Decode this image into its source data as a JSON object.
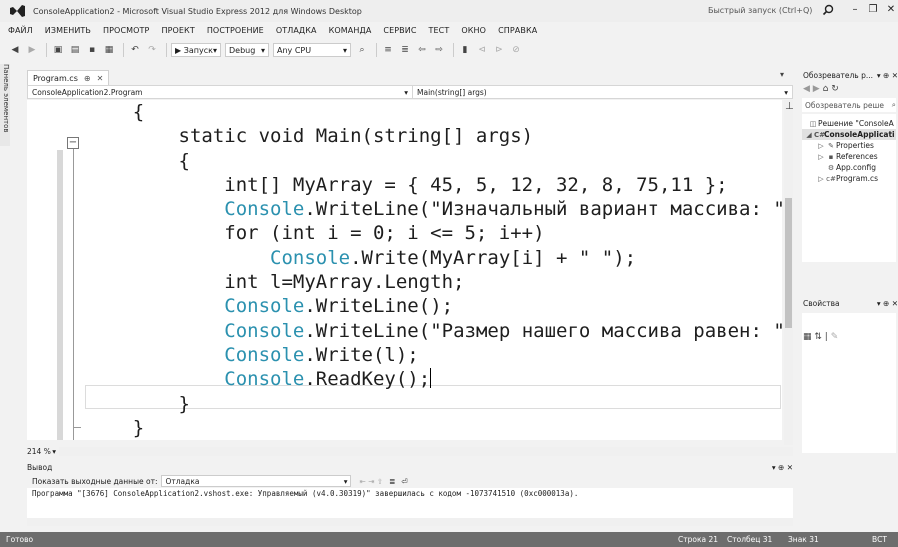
{
  "window": {
    "title": "ConsoleApplication2 - Microsoft Visual Studio Express 2012 для Windows Desktop",
    "quick_launch_placeholder": "Быстрый запуск (Ctrl+Q)",
    "controls": {
      "minimize": "–",
      "restore": "❐",
      "close": "✕"
    }
  },
  "menu": [
    "ФАЙЛ",
    "ИЗМЕНИТЬ",
    "ПРОСМОТР",
    "ПРОЕКТ",
    "ПОСТРОЕНИЕ",
    "ОТЛАДКА",
    "КОМАНДА",
    "СЕРВИС",
    "ТЕСТ",
    "ОКНО",
    "СПРАВКА"
  ],
  "toolbar": {
    "start_label": "▶ Запуск",
    "config_value": "Debug",
    "platform_value": "Any CPU"
  },
  "left_rail": {
    "label": "Панель элементов"
  },
  "editor": {
    "tab_label": "Program.cs",
    "tab_pin": "⊕",
    "tab_close": "✕",
    "nav_class": "ConsoleApplication2.Program",
    "nav_member": "Main(string[] args)",
    "zoom": "214 %",
    "code_lines": [
      "    {",
      "        static void Main(string[] args)",
      "        {",
      "            int[] MyArray = { 45, 5, 12, 32, 8, 75,11 };",
      "            Console.WriteLine(\"Изначальный вариант массива: \");",
      "            for (int i = 0; i <= 5; i++)",
      "                Console.Write(MyArray[i] + \" \");",
      "            int l=MyArray.Length;",
      "            Console.WriteLine();",
      "            Console.WriteLine(\"Размер нашего массива равен: \");",
      "            Console.Write(l);",
      "            Console.ReadKey();",
      "        }",
      "    }"
    ]
  },
  "solution_explorer": {
    "header": "Обозреватель р...",
    "search_placeholder": "Обозреватель реше",
    "items": [
      {
        "label": "Решение \"ConsoleA",
        "icon": "solution-icon"
      },
      {
        "label": "ConsoleApplicati",
        "icon": "csharp-project-icon",
        "selected": true
      },
      {
        "label": "Properties",
        "icon": "wrench-icon"
      },
      {
        "label": "References",
        "icon": "references-icon"
      },
      {
        "label": "App.config",
        "icon": "config-file-icon"
      },
      {
        "label": "Program.cs",
        "icon": "csharp-file-icon"
      }
    ]
  },
  "properties": {
    "header": "Свойства"
  },
  "output": {
    "header": "Вывод",
    "show_from_label": "Показать выходные данные от:",
    "source_value": "Отладка",
    "text": "Программа \"[3676] ConsoleApplication2.vshost.exe: Управляемый (v4.0.30319)\" завершилась с кодом -1073741510 (0xc000013a)."
  },
  "status": {
    "ready": "Готово",
    "line": "Строка 21",
    "col": "Столбец 31",
    "char": "Знак 31",
    "ins": "ВСТ"
  }
}
